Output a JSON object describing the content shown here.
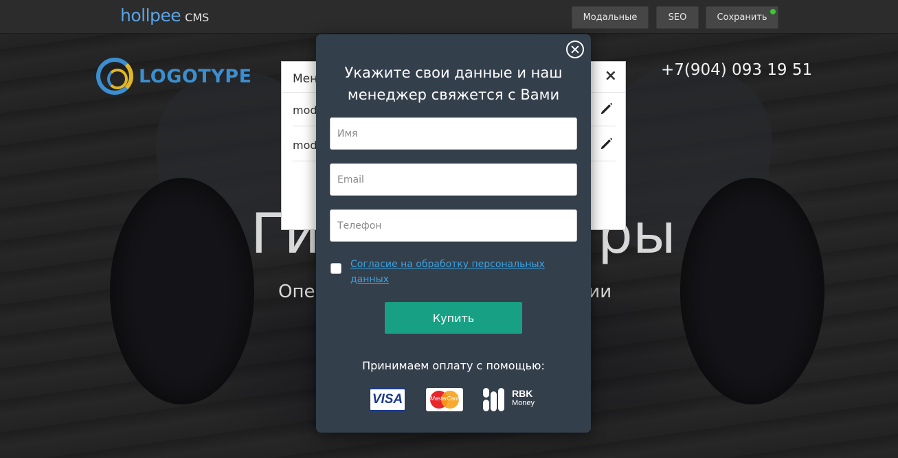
{
  "cms": {
    "brand": "hollpee",
    "brand_suffix": "CMS",
    "buttons": {
      "modals": "Модальные",
      "seo": "SEO",
      "save": "Сохранить"
    },
    "status_color": "#38c934"
  },
  "site": {
    "logo_text": "LOGOTYPE",
    "phone": "+7(904) 093 19 51",
    "hero_title_left": "Ги",
    "hero_title_right": "ры",
    "hero_sub_left": "Опер",
    "hero_sub_right": "сии"
  },
  "manager": {
    "title": "Мен",
    "close": "×",
    "rows": [
      {
        "name": "mod"
      },
      {
        "name": "mod"
      }
    ]
  },
  "modal": {
    "title": "Укажите свои данные и наш менеджер свяжется с Вами",
    "fields": {
      "name_placeholder": "Имя",
      "email_placeholder": "Email",
      "phone_placeholder": "Телефон"
    },
    "consent_label": "Согласие на обработку персональных данных",
    "buy_label": "Купить",
    "payment_label": "Принимаем оплату с помощью:",
    "payment_logos": {
      "visa": "VISA",
      "mastercard": "MasterCard",
      "rbk_top": "RBK",
      "rbk_bottom": "Money"
    },
    "colors": {
      "background": "#343f4c",
      "button": "#18a085",
      "link": "#3aa3e3"
    }
  }
}
